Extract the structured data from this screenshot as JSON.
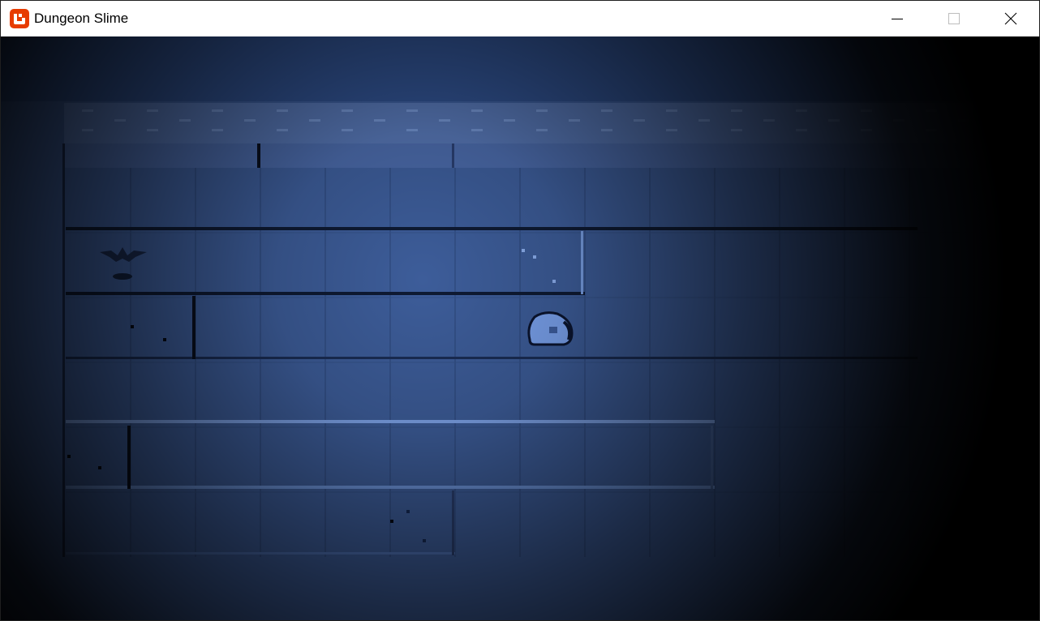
{
  "window": {
    "title": "Dungeon Slime",
    "minimize_icon": "minimize-icon",
    "maximize_icon": "maximize-icon",
    "close_icon": "close-icon",
    "app_icon": "monogame-logo-icon",
    "accent_color": "#e73c00"
  },
  "game": {
    "scene": "dungeon",
    "grid_columns": 13,
    "grid_rows": 6,
    "floor_color": "#3a5a96",
    "light_color": "#6b9cf2",
    "darkness_color": "#000000",
    "entities": [
      {
        "type": "slime",
        "name": "player-slime",
        "col": 7,
        "row": 2
      },
      {
        "type": "bat",
        "name": "enemy-bat",
        "col": 0,
        "row": 1
      }
    ]
  }
}
